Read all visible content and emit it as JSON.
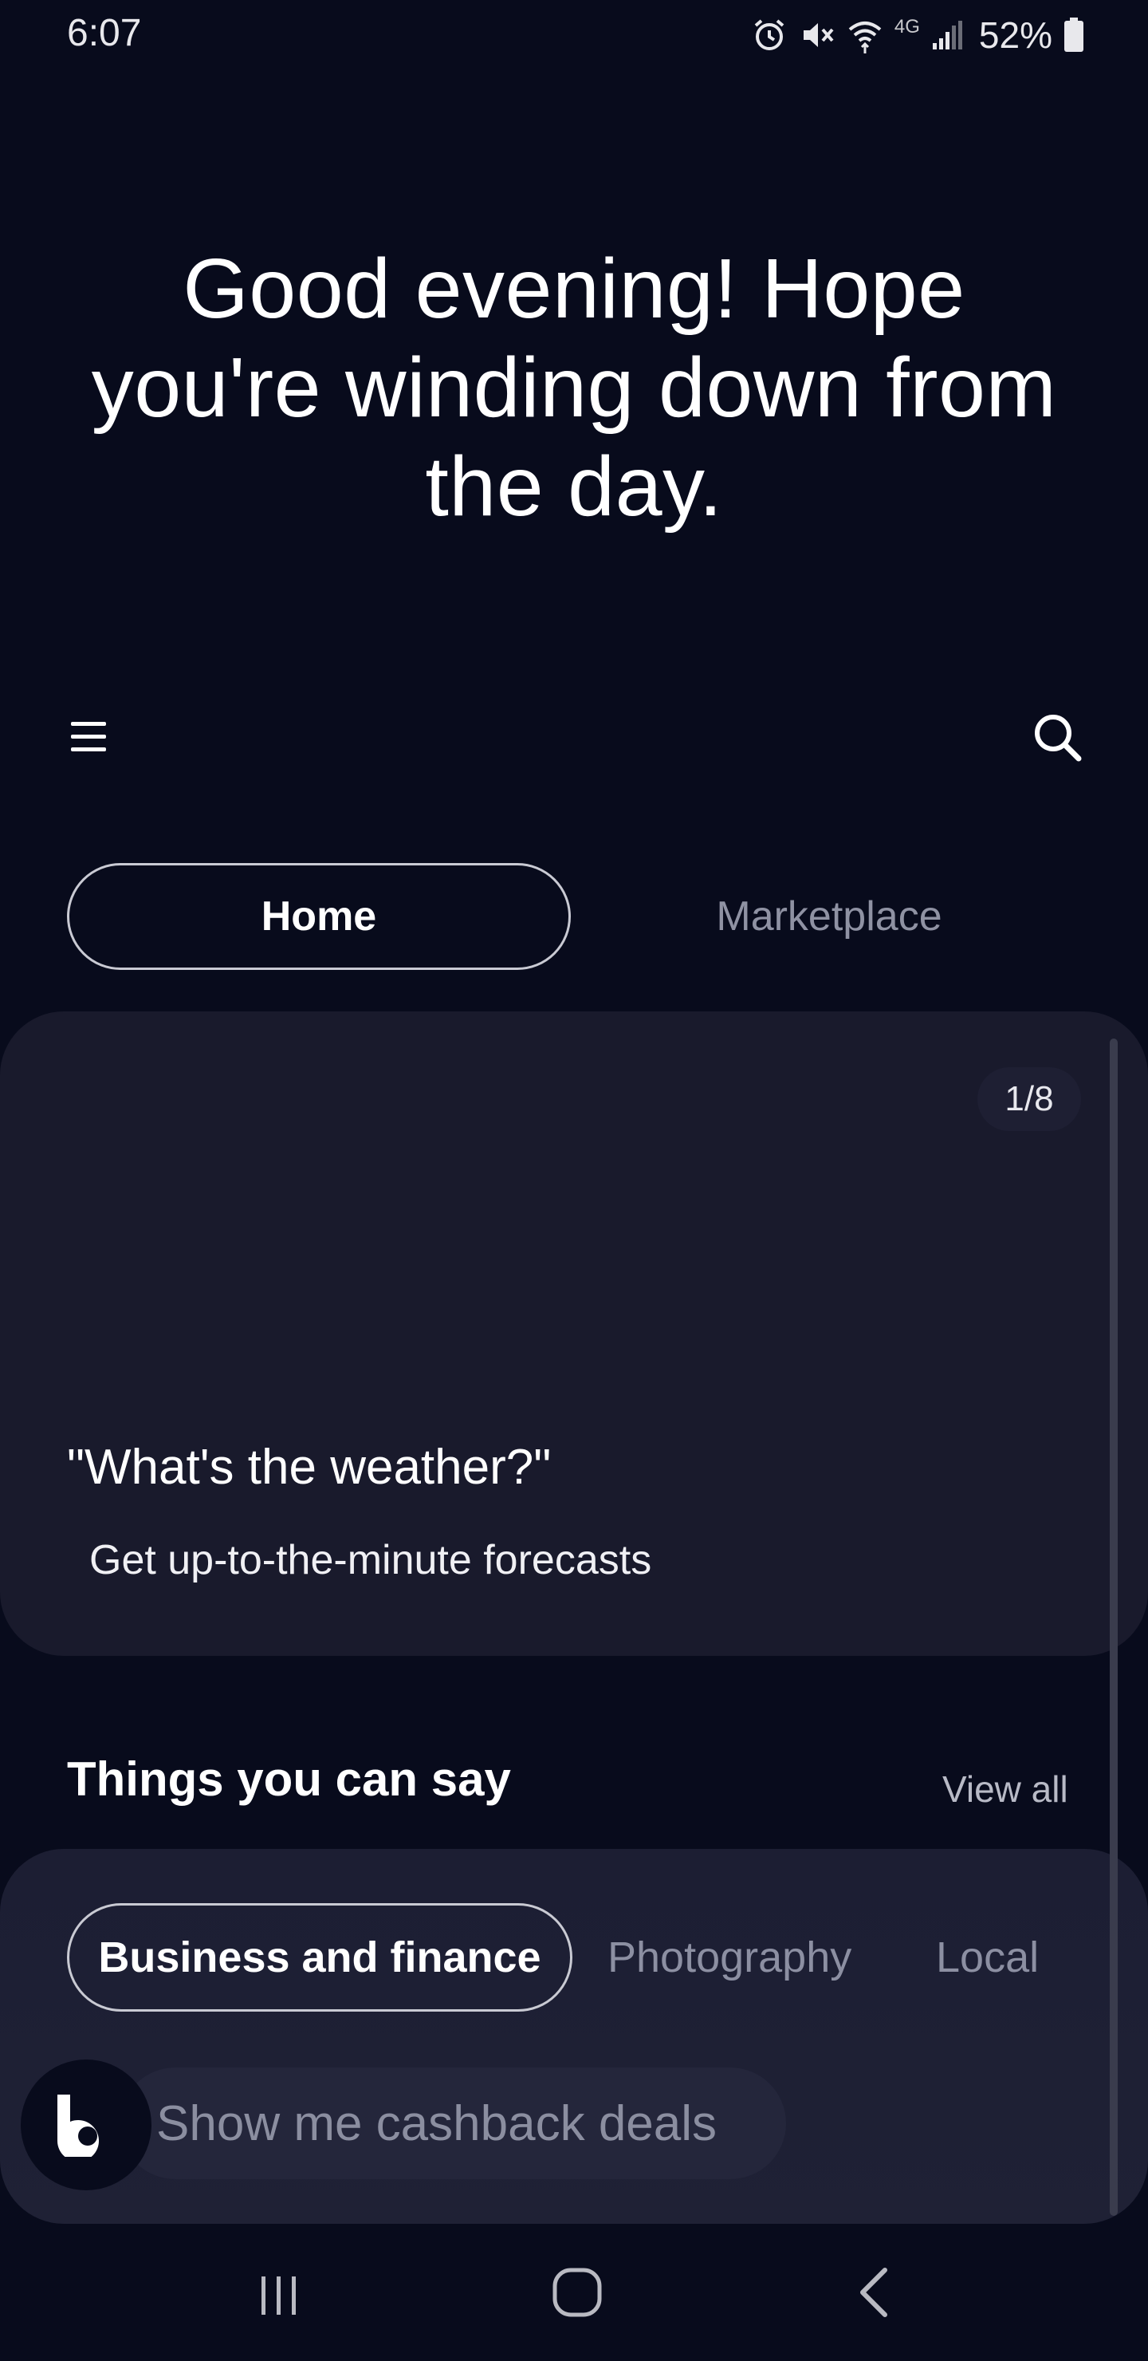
{
  "status_bar": {
    "time": "6:07",
    "network": "4G",
    "battery_percent": "52%",
    "icons": [
      "alarm-icon",
      "mute-icon",
      "wifi-icon",
      "signal-icon",
      "battery-icon"
    ]
  },
  "greeting": "Good evening! Hope you're winding down from the day.",
  "toolbar": {
    "menu_icon": "hamburger-menu-icon",
    "search_icon": "search-icon"
  },
  "tabs": [
    {
      "label": "Home",
      "selected": true
    },
    {
      "label": "Marketplace",
      "selected": false
    }
  ],
  "card": {
    "pager": "1/8",
    "title": "\"What's the weather?\"",
    "subtitle": "Get up-to-the-minute forecasts"
  },
  "things_you_can_say": {
    "title": "Things you can say",
    "view_all": "View all",
    "categories": [
      {
        "label": "Business and finance",
        "selected": true
      },
      {
        "label": "Photography",
        "selected": false
      },
      {
        "label": "Local",
        "selected": false
      }
    ],
    "suggestion": "Show me cashback deals"
  },
  "colors": {
    "background": "#080b1c",
    "card": "#191a2c",
    "muted_text": "#8f92a3"
  },
  "nav_bar": {
    "icons": [
      "recents-icon",
      "home-icon",
      "back-icon"
    ]
  }
}
